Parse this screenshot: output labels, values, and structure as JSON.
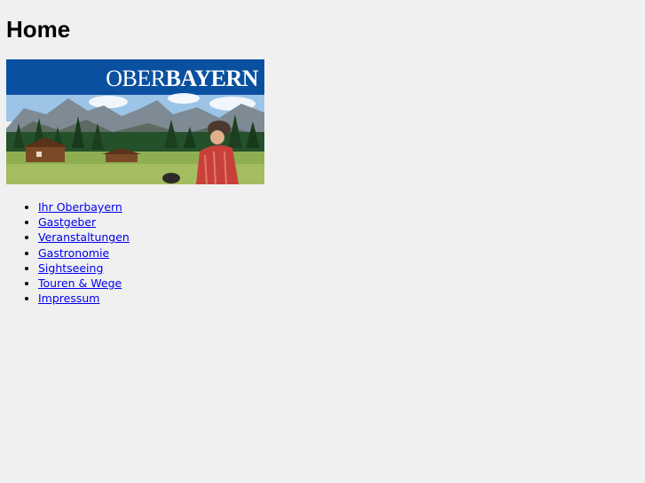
{
  "page": {
    "title": "Home"
  },
  "banner": {
    "brand_light": "OBER",
    "brand_bold": "BAYERN",
    "brand_bar_color": "#0a50a0",
    "scene": "alpine meadow with mountain huts and hiker"
  },
  "nav": {
    "items": [
      {
        "label": "Ihr Oberbayern"
      },
      {
        "label": "Gastgeber"
      },
      {
        "label": "Veranstaltungen"
      },
      {
        "label": "Gastronomie"
      },
      {
        "label": "Sightseeing"
      },
      {
        "label": "Touren & Wege"
      },
      {
        "label": "Impressum"
      }
    ],
    "link_color": "#0000ee"
  }
}
